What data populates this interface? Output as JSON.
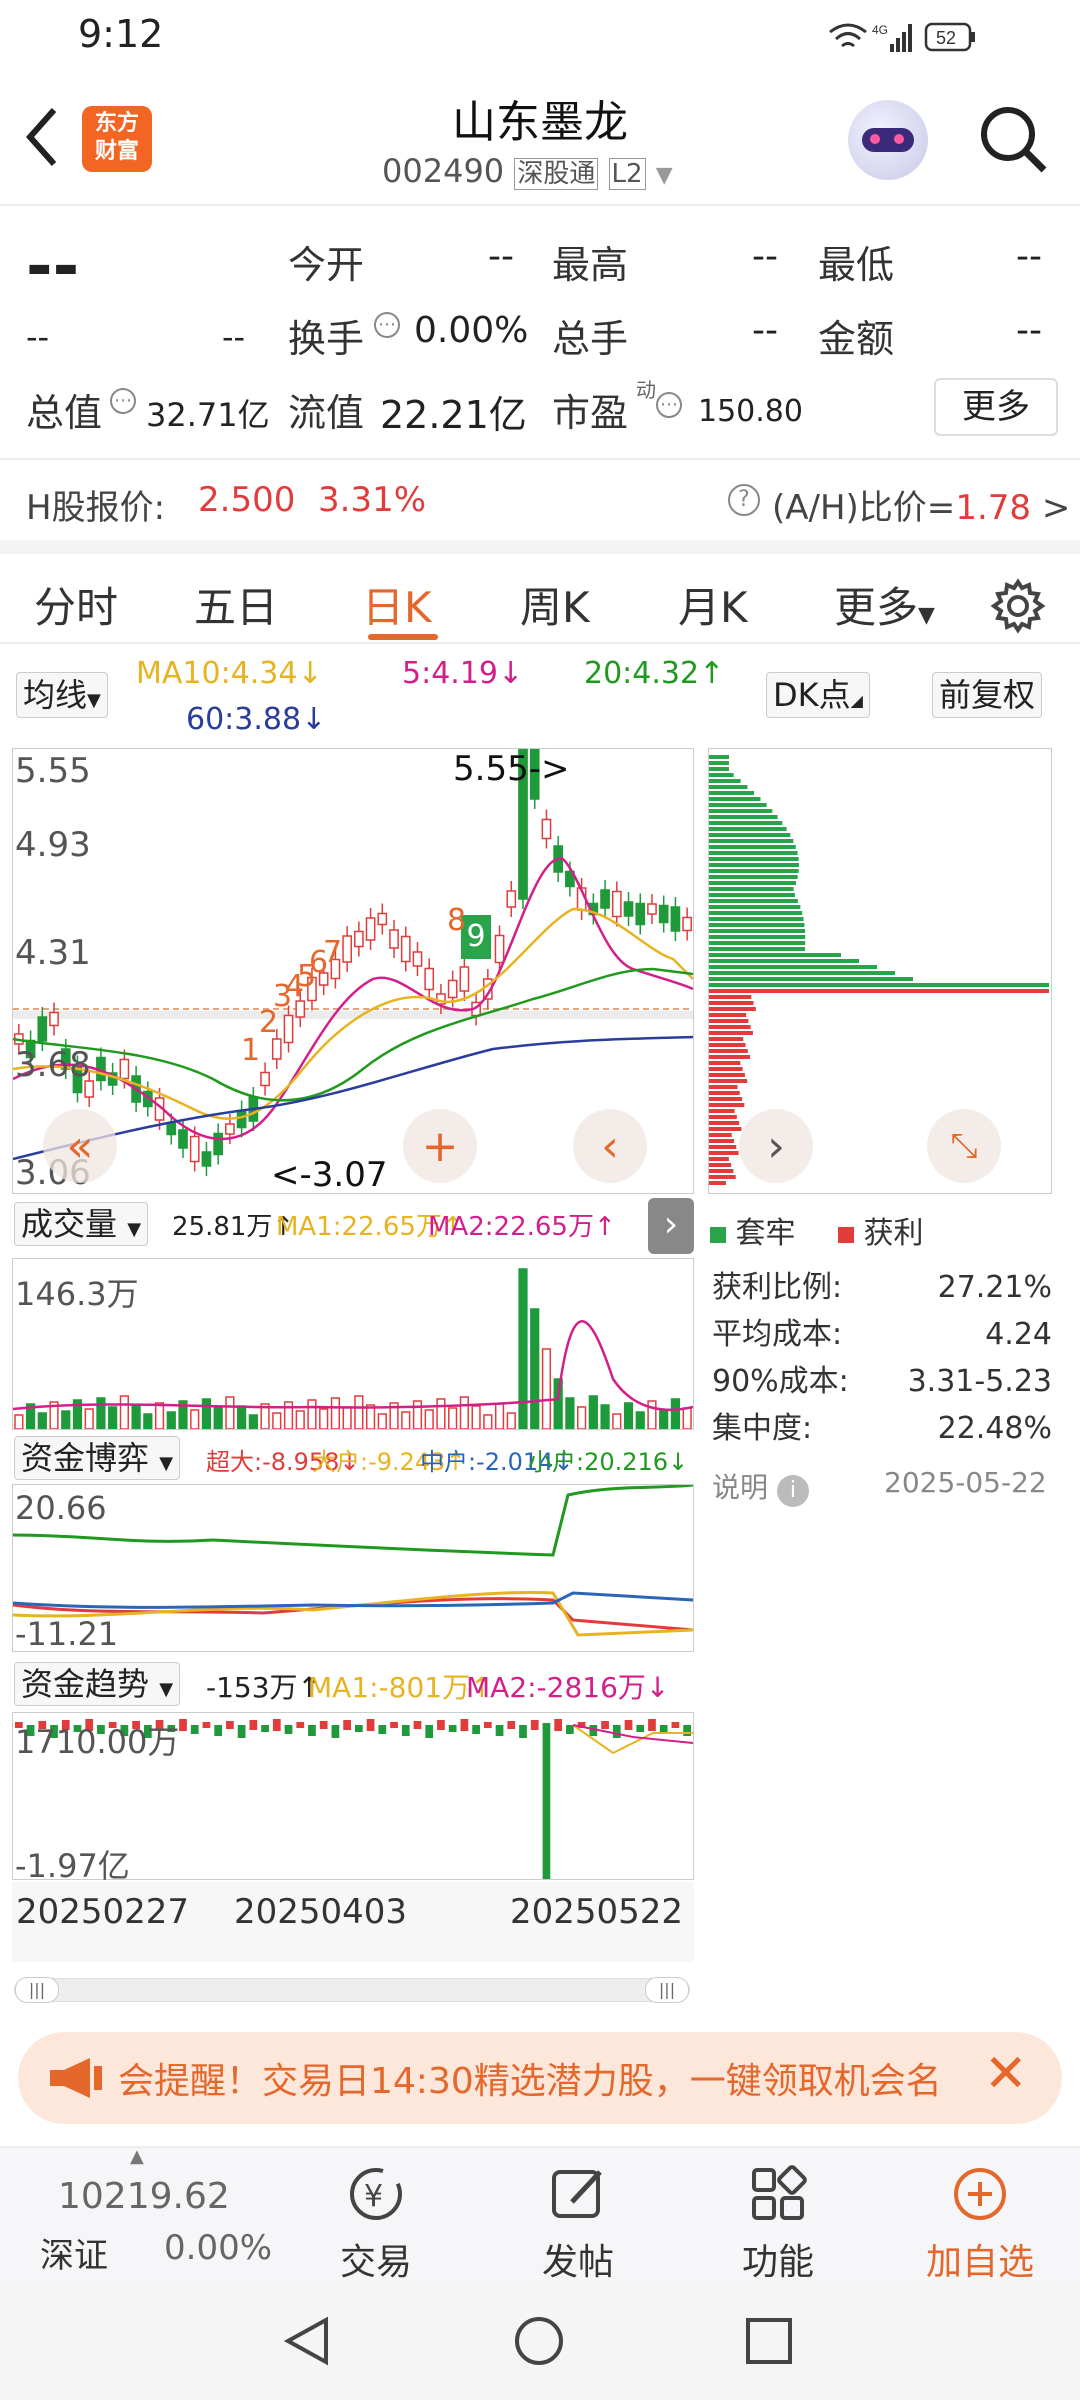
{
  "status": {
    "time": "9:12",
    "network": "4G",
    "battery": "52"
  },
  "header": {
    "title": "山东墨龙",
    "code": "002490",
    "tag1": "深股通",
    "tag2": "L2",
    "logo": "东方\n财富",
    "back_icon": "back-arrow-icon",
    "search_icon": "search-icon"
  },
  "quote": {
    "price": "--",
    "change": "--",
    "change_pct": "--",
    "open_label": "今开",
    "open": "--",
    "high_label": "最高",
    "high": "--",
    "low_label": "最低",
    "low": "--",
    "turnover_label": "换手",
    "turnover": "0.00%",
    "vol_label": "总手",
    "vol": "--",
    "amount_label": "金额",
    "amount": "--",
    "mcap_label": "总值",
    "mcap": "32.71亿",
    "float_label": "流值",
    "float": "22.21亿",
    "pe_label": "市盈",
    "pe_sup": "动",
    "pe": "150.80",
    "more": "更多",
    "h_label": "H股报价:",
    "h_price": "2.500",
    "h_pct": "3.31%",
    "ah_label": "(A/H)比价=",
    "ah_value": "1.78",
    "ah_arrow": ">"
  },
  "tabs": [
    "分时",
    "五日",
    "日K",
    "周K",
    "月K",
    "更多"
  ],
  "active_tab": "日K",
  "indicators": {
    "ma_select": "均线",
    "ma10": "MA10:4.34↓",
    "ma5": "5:4.19↓",
    "ma20": "20:4.32↑",
    "ma60": "60:3.88↓",
    "dk": "DK点",
    "adjust": "前复权"
  },
  "kline": {
    "y_labels": [
      "5.55",
      "4.93",
      "4.31",
      "3.68",
      "3.06"
    ],
    "high_mark": "5.55->",
    "low_mark": "<-3.07",
    "signal_nums": [
      "1",
      "2",
      "3",
      "4",
      "5",
      "6",
      "7",
      "8",
      "9"
    ]
  },
  "volume": {
    "select": "成交量",
    "vol": "25.81万↑",
    "ma1": "MA1:22.65万↑",
    "ma2": "MA2:22.65万↑",
    "y_label": "146.3万"
  },
  "fund_game": {
    "select": "资金博弈",
    "super": "超大:-8.958↓",
    "big": "大户:-9.243↑",
    "mid": "中户:-2.014↓",
    "small": "小户:20.216↓",
    "y_top": "20.66",
    "y_bottom": "-11.21"
  },
  "fund_trend": {
    "select": "资金趋势",
    "val": "-153万↑",
    "ma1": "MA1:-801万↑",
    "ma2": "MA2:-2816万↓",
    "y_top": "1710.00万",
    "y_bottom": "-1.97亿"
  },
  "dates": [
    "20250227",
    "20250403",
    "20250522"
  ],
  "chips": {
    "legend_trap": "套牢",
    "legend_profit": "获利",
    "rows": [
      {
        "k": "获利比例:",
        "v": "27.21%"
      },
      {
        "k": "平均成本:",
        "v": "4.24"
      },
      {
        "k": "90%成本:",
        "v": "3.31-5.23"
      },
      {
        "k": "集中度:",
        "v": "22.48%"
      }
    ],
    "note": "说明",
    "date": "2025-05-22"
  },
  "banner": {
    "text": "会提醒！交易日14:30精选潜力股，一键领取机会名"
  },
  "bottom_nav": {
    "index_value": "10219.62",
    "index_name": "深证",
    "index_pct": "0.00%",
    "items": [
      "交易",
      "发帖",
      "功能",
      "加自选"
    ]
  },
  "colors": {
    "accent": "#e4672b",
    "up": "#e23b3b",
    "down": "#1f9a3a",
    "ma5": "#d41e8a",
    "ma10": "#e8b320",
    "ma20": "#1f9a1f",
    "ma60": "#2a3d9c"
  }
}
